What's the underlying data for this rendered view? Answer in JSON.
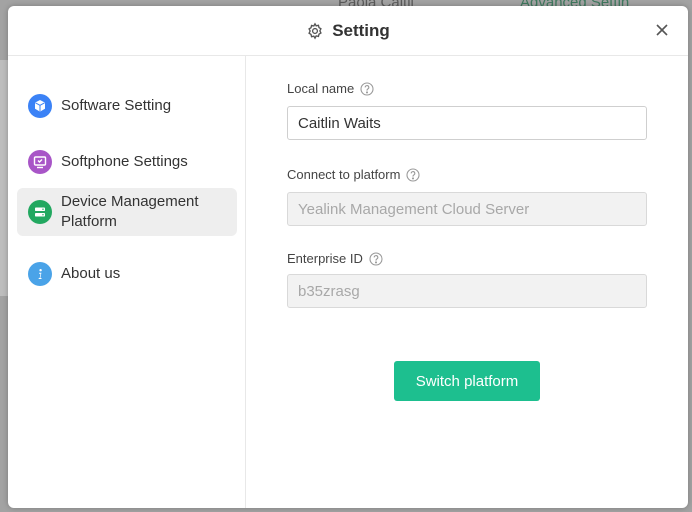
{
  "background": {
    "partial_text_left": "Paola Caitli",
    "partial_text_right": "Advanced Settin"
  },
  "dialog": {
    "title": "Setting",
    "header_icon": "gear-icon",
    "close_icon": "close-icon"
  },
  "sidebar": {
    "items": [
      {
        "label": "Software Setting",
        "icon": "cube-icon",
        "color": "#3b82f6",
        "active": false
      },
      {
        "label": "Softphone Settings",
        "icon": "phone-screen-icon",
        "color": "#a855c7",
        "active": false
      },
      {
        "label": "Device Management Platform",
        "icon": "server-icon",
        "color": "#22a860",
        "active": true
      },
      {
        "label": "About us",
        "icon": "info-icon",
        "color": "#4aa3e8",
        "active": false
      }
    ]
  },
  "form": {
    "local_name": {
      "label": "Local name",
      "value": "Caitlin Waits"
    },
    "connect_platform": {
      "label": "Connect to platform",
      "value": "Yealink Management Cloud Server"
    },
    "enterprise_id": {
      "label": "Enterprise ID",
      "value": "b35zrasg"
    },
    "switch_button_label": "Switch platform"
  },
  "colors": {
    "accent": "#1dbf8f",
    "active_nav_bg": "#eeeeee"
  }
}
